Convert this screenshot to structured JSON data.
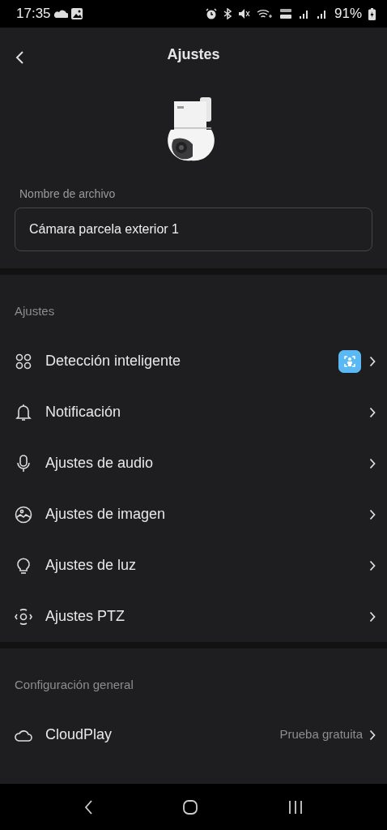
{
  "status_bar": {
    "time": "17:35",
    "battery": "91%"
  },
  "header": {
    "title": "Ajustes"
  },
  "device": {
    "name_label": "Nombre de archivo",
    "name_value": "Cámara parcela exterior 1"
  },
  "sections": [
    {
      "title": "Ajustes",
      "items": [
        {
          "label": "Detección inteligente",
          "badge": true
        },
        {
          "label": "Notificación"
        },
        {
          "label": "Ajustes de audio"
        },
        {
          "label": "Ajustes de imagen"
        },
        {
          "label": "Ajustes de luz"
        },
        {
          "label": "Ajustes PTZ"
        }
      ]
    },
    {
      "title": "Configuración general",
      "items": [
        {
          "label": "CloudPlay",
          "value": "Prueba gratuita"
        }
      ]
    }
  ]
}
